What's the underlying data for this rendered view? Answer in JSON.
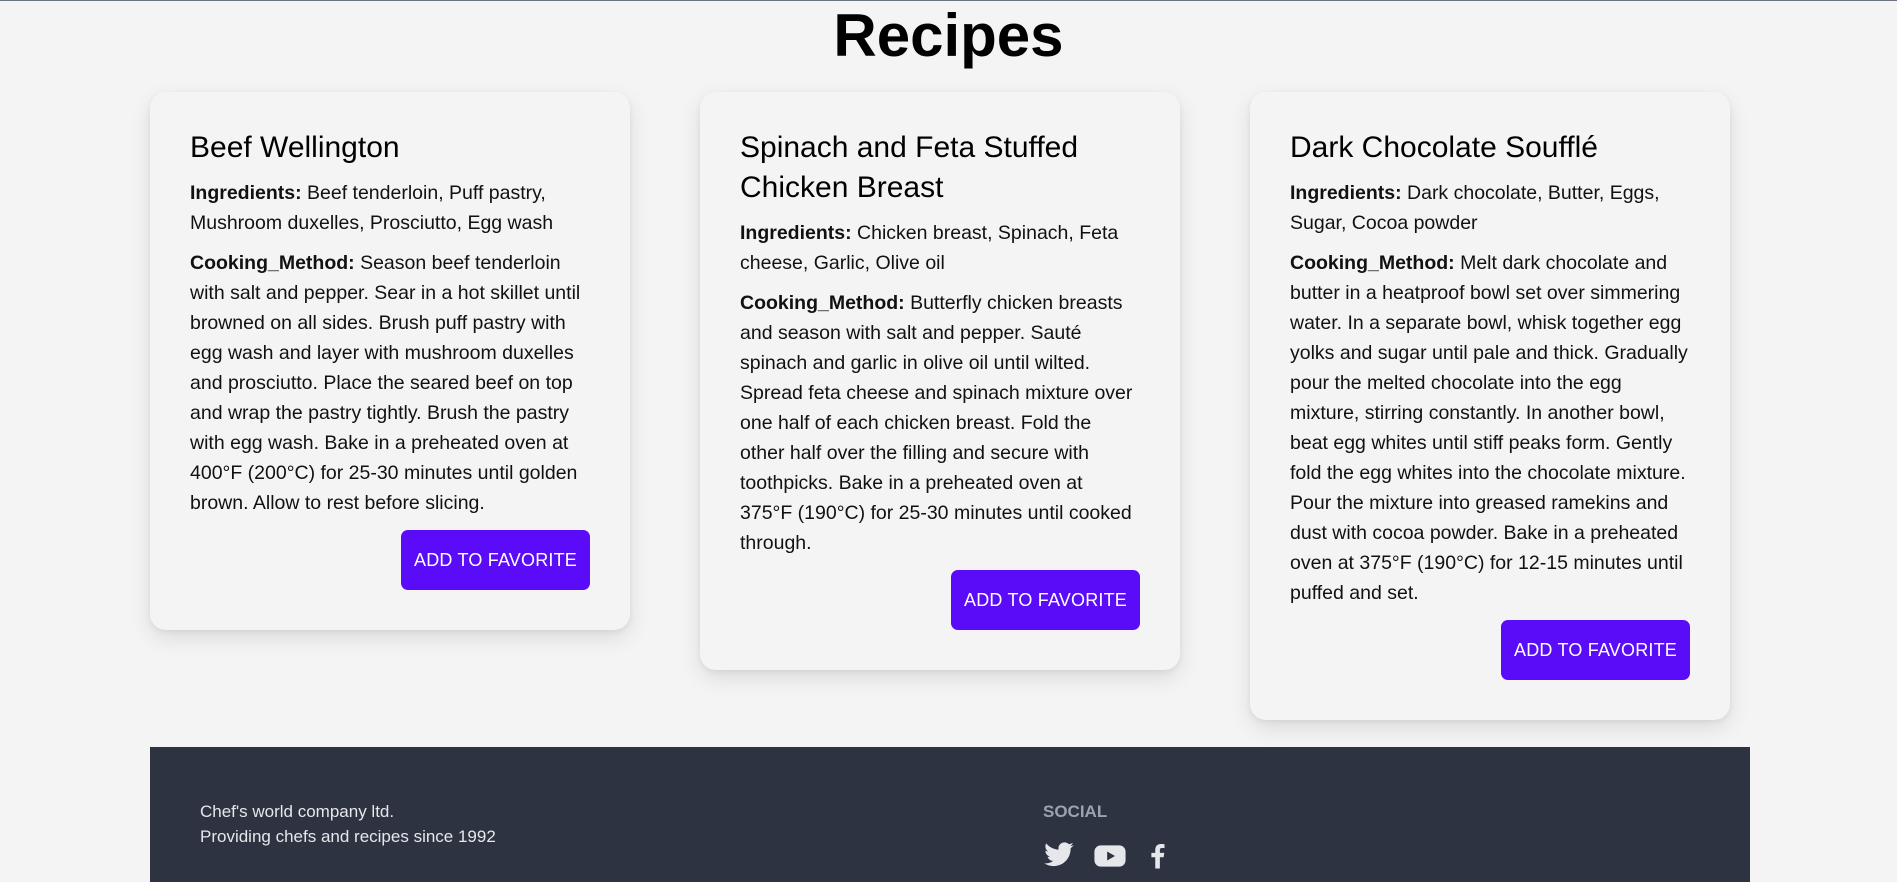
{
  "page": {
    "title": "Recipes"
  },
  "recipes": [
    {
      "name": "Beef Wellington",
      "ingredients_label": "Ingredients:",
      "ingredients": "Beef tenderloin, Puff pastry, Mushroom duxelles, Prosciutto, Egg wash",
      "method_label": "Cooking_Method:",
      "method": "Season beef tenderloin with salt and pepper. Sear in a hot skillet until browned on all sides. Brush puff pastry with egg wash and layer with mushroom duxelles and prosciutto. Place the seared beef on top and wrap the pastry tightly. Brush the pastry with egg wash. Bake in a preheated oven at 400°F (200°C) for 25-30 minutes until golden brown. Allow to rest before slicing.",
      "button_label": "ADD TO FAVORITE"
    },
    {
      "name": "Spinach and Feta Stuffed Chicken Breast",
      "ingredients_label": "Ingredients:",
      "ingredients": "Chicken breast, Spinach, Feta cheese, Garlic, Olive oil",
      "method_label": "Cooking_Method:",
      "method": "Butterfly chicken breasts and season with salt and pepper. Sauté spinach and garlic in olive oil until wilted. Spread feta cheese and spinach mixture over one half of each chicken breast. Fold the other half over the filling and secure with toothpicks. Bake in a preheated oven at 375°F (190°C) for 25-30 minutes until cooked through.",
      "button_label": "ADD TO FAVORITE"
    },
    {
      "name": "Dark Chocolate Soufflé",
      "ingredients_label": "Ingredients:",
      "ingredients": "Dark chocolate, Butter, Eggs, Sugar, Cocoa powder",
      "method_label": "Cooking_Method:",
      "method": "Melt dark chocolate and butter in a heatproof bowl set over simmering water. In a separate bowl, whisk together egg yolks and sugar until pale and thick. Gradually pour the melted chocolate into the egg mixture, stirring constantly. In another bowl, beat egg whites until stiff peaks form. Gently fold the egg whites into the chocolate mixture. Pour the mixture into greased ramekins and dust with cocoa powder. Bake in a preheated oven at 375°F (190°C) for 12-15 minutes until puffed and set.",
      "button_label": "ADD TO FAVORITE"
    }
  ],
  "footer": {
    "company_name": "Chef's world company ltd.",
    "tagline": "Providing chefs and recipes since 1992",
    "social_title": "SOCIAL",
    "social_icons": [
      "twitter-icon",
      "youtube-icon",
      "facebook-icon"
    ]
  },
  "colors": {
    "accent": "#5a0cf9",
    "footer_bg": "#2d3340",
    "page_bg": "#f4f4f4"
  }
}
